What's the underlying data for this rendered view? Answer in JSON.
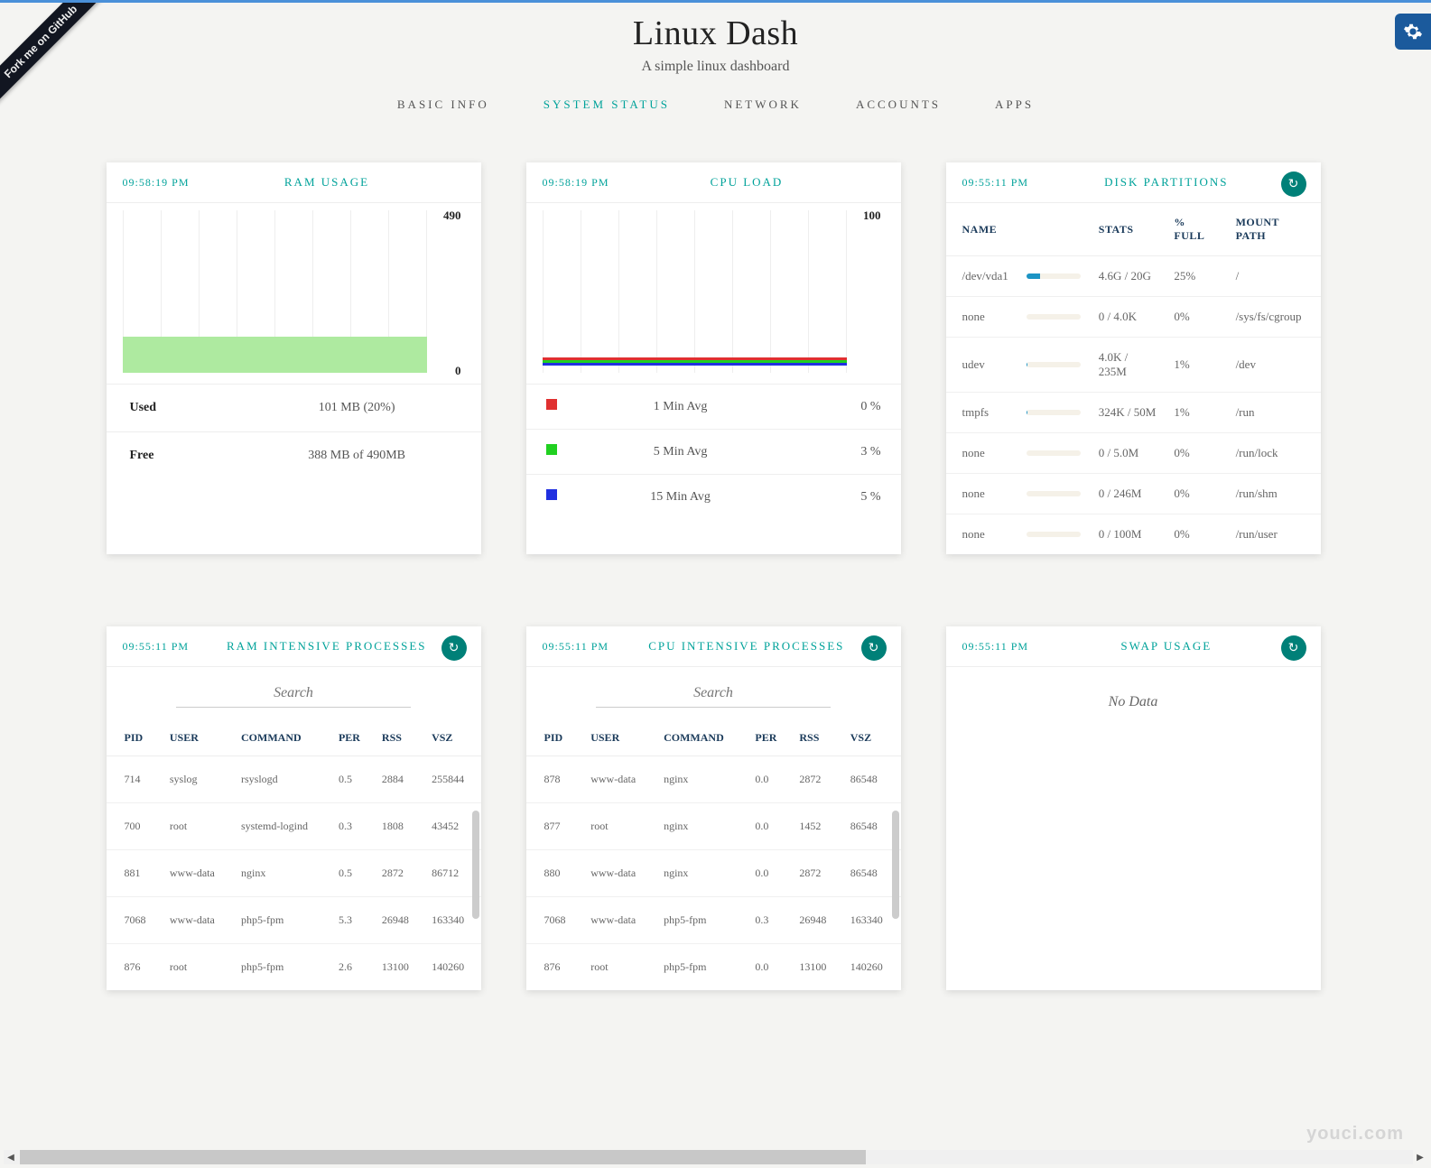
{
  "ribbon": "Fork me on GitHub",
  "title": "Linux Dash",
  "subtitle": "A simple linux dashboard",
  "nav": {
    "basic": "BASIC INFO",
    "system": "SYSTEM STATUS",
    "network": "NETWORK",
    "accounts": "ACCOUNTS",
    "apps": "APPS"
  },
  "time_a": "09:58:19 PM",
  "time_b": "09:55:11 PM",
  "ram": {
    "title": "RAM USAGE",
    "max": "490",
    "min": "0",
    "used_label": "Used",
    "used_val": "101 MB (20%)",
    "free_label": "Free",
    "free_val": "388 MB of 490MB"
  },
  "cpu": {
    "title": "CPU LOAD",
    "max": "100",
    "legend": [
      {
        "color": "#e03030",
        "label": "1 Min Avg",
        "val": "0 %"
      },
      {
        "color": "#20d020",
        "label": "5 Min Avg",
        "val": "3 %"
      },
      {
        "color": "#2030e0",
        "label": "15 Min Avg",
        "val": "5 %"
      }
    ]
  },
  "disk": {
    "title": "DISK PARTITIONS",
    "cols": {
      "name": "NAME",
      "stats": "STATS",
      "full": "% FULL",
      "mount": "MOUNT PATH"
    },
    "rows": [
      {
        "name": "/dev/vda1",
        "pct": 25,
        "stats": "4.6G / 20G",
        "full": "25%",
        "mount": "/"
      },
      {
        "name": "none",
        "pct": 0,
        "stats": "0 / 4.0K",
        "full": "0%",
        "mount": "/sys/fs/cgroup"
      },
      {
        "name": "udev",
        "pct": 1,
        "stats": "4.0K / 235M",
        "full": "1%",
        "mount": "/dev"
      },
      {
        "name": "tmpfs",
        "pct": 1,
        "stats": "324K / 50M",
        "full": "1%",
        "mount": "/run"
      },
      {
        "name": "none",
        "pct": 0,
        "stats": "0 / 5.0M",
        "full": "0%",
        "mount": "/run/lock"
      },
      {
        "name": "none",
        "pct": 0,
        "stats": "0 / 246M",
        "full": "0%",
        "mount": "/run/shm"
      },
      {
        "name": "none",
        "pct": 0,
        "stats": "0 / 100M",
        "full": "0%",
        "mount": "/run/user"
      }
    ]
  },
  "search_placeholder": "Search",
  "proc_cols": {
    "pid": "PID",
    "user": "USER",
    "cmd": "COMMAND",
    "per": "PER",
    "rss": "RSS",
    "vsz": "VSZ"
  },
  "ram_proc": {
    "title": "RAM INTENSIVE PROCESSES",
    "rows": [
      {
        "pid": "714",
        "user": "syslog",
        "cmd": "rsyslogd",
        "per": "0.5",
        "rss": "2884",
        "vsz": "255844"
      },
      {
        "pid": "700",
        "user": "root",
        "cmd": "systemd-logind",
        "per": "0.3",
        "rss": "1808",
        "vsz": "43452"
      },
      {
        "pid": "881",
        "user": "www-data",
        "cmd": "nginx",
        "per": "0.5",
        "rss": "2872",
        "vsz": "86712"
      },
      {
        "pid": "7068",
        "user": "www-data",
        "cmd": "php5-fpm",
        "per": "5.3",
        "rss": "26948",
        "vsz": "163340"
      },
      {
        "pid": "876",
        "user": "root",
        "cmd": "php5-fpm",
        "per": "2.6",
        "rss": "13100",
        "vsz": "140260"
      }
    ]
  },
  "cpu_proc": {
    "title": "CPU INTENSIVE PROCESSES",
    "rows": [
      {
        "pid": "878",
        "user": "www-data",
        "cmd": "nginx",
        "per": "0.0",
        "rss": "2872",
        "vsz": "86548"
      },
      {
        "pid": "877",
        "user": "root",
        "cmd": "nginx",
        "per": "0.0",
        "rss": "1452",
        "vsz": "86548"
      },
      {
        "pid": "880",
        "user": "www-data",
        "cmd": "nginx",
        "per": "0.0",
        "rss": "2872",
        "vsz": "86548"
      },
      {
        "pid": "7068",
        "user": "www-data",
        "cmd": "php5-fpm",
        "per": "0.3",
        "rss": "26948",
        "vsz": "163340"
      },
      {
        "pid": "876",
        "user": "root",
        "cmd": "php5-fpm",
        "per": "0.0",
        "rss": "13100",
        "vsz": "140260"
      }
    ]
  },
  "swap": {
    "title": "SWAP USAGE",
    "nodata": "No Data"
  },
  "watermark": "youci.com",
  "chart_data": [
    {
      "type": "area",
      "title": "RAM USAGE",
      "ylabel": "MB",
      "ylim": [
        0,
        490
      ],
      "series": [
        {
          "name": "Used",
          "values": [
            101
          ]
        }
      ],
      "annotations": {
        "used_pct": 20,
        "free_mb": 388,
        "total_mb": 490
      }
    },
    {
      "type": "line",
      "title": "CPU LOAD",
      "ylabel": "%",
      "ylim": [
        0,
        100
      ],
      "series": [
        {
          "name": "1 Min Avg",
          "color": "#e03030",
          "latest": 0
        },
        {
          "name": "5 Min Avg",
          "color": "#20d020",
          "latest": 3
        },
        {
          "name": "15 Min Avg",
          "color": "#2030e0",
          "latest": 5
        }
      ]
    }
  ]
}
